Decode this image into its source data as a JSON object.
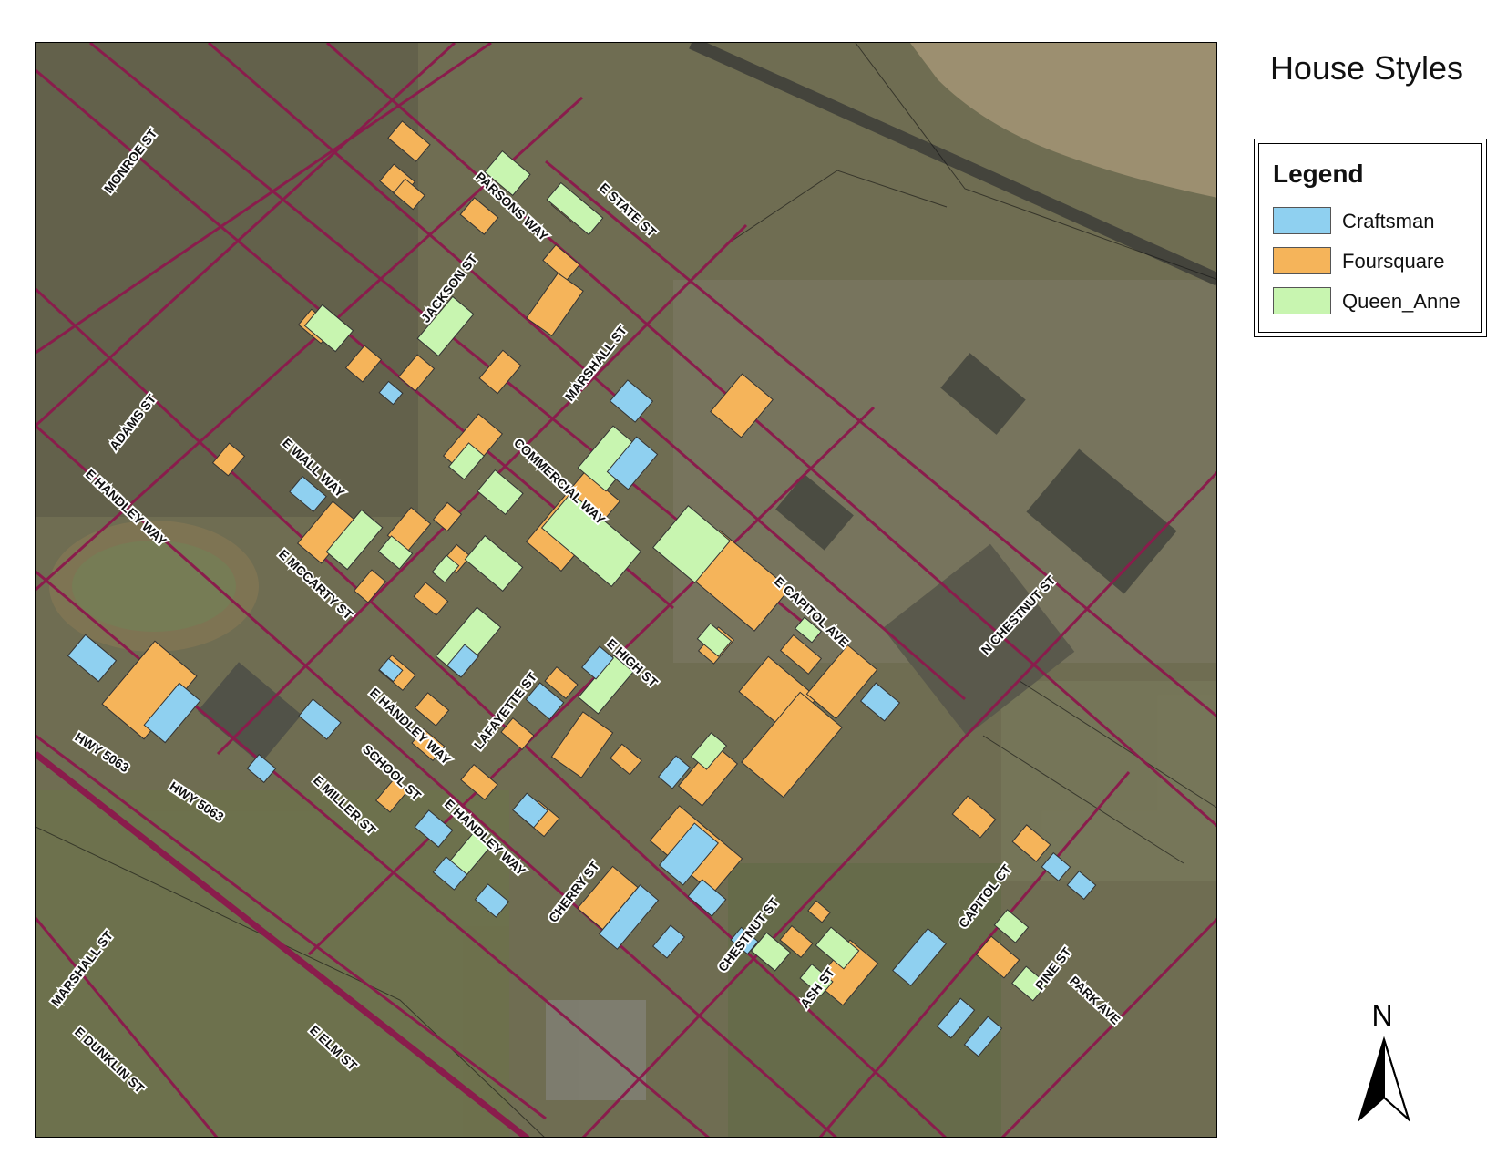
{
  "title": "House Styles",
  "legend": {
    "title": "Legend",
    "items": [
      {
        "label": "Craftsman",
        "color": "#8fd0f0"
      },
      {
        "label": "Foursquare",
        "color": "#f5b45a"
      },
      {
        "label": "Queen_Anne",
        "color": "#c8f5b0"
      }
    ]
  },
  "north_label": "N",
  "colors": {
    "road": "#8a1c4c",
    "river": "#9c8f70",
    "aerial": "#6f6d52"
  },
  "street_labels": [
    "MONROE ST",
    "PARSONS WAY",
    "E STATE ST",
    "JACKSON ST",
    "MARSHALL ST",
    "ADAMS ST",
    "E WALL WAY",
    "COMMERCIAL WAY",
    "E HANDLEY WAY",
    "E MCCARTY ST",
    "E CAPITOL AVE",
    "N CHESTNUT ST",
    "E HIGH ST",
    "LAFAYETTE ST",
    "E HANDLEY WAY",
    "HWY 5063",
    "SCHOOL ST",
    "HWY 5063",
    "E MILLER ST",
    "E HANDLEY WAY",
    "CHERRY ST",
    "CHESTNUT ST",
    "CAPITOL CT",
    "MARSHALL ST",
    "ASH ST",
    "PINE ST",
    "PARK AVE",
    "E ELM ST",
    "E DUNKLIN ST"
  ]
}
